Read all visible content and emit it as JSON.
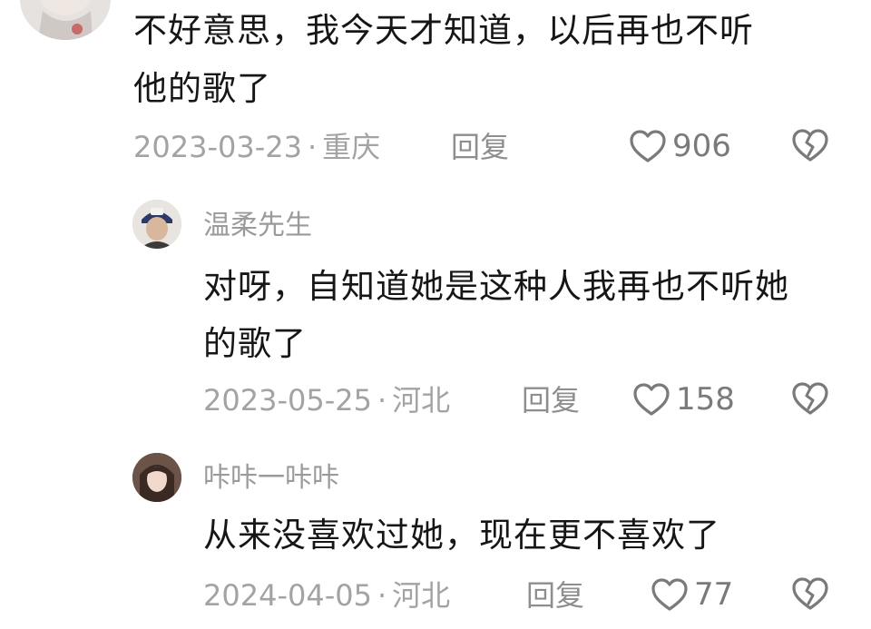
{
  "colors": {
    "text": "#161616",
    "meta": "#a3a3a3",
    "icon": "#7a7a7a"
  },
  "comments": [
    {
      "avatar": "partial-avatar-cut-off",
      "lines": [
        "不好意思，我今天才知道，以后再也不听",
        "他的歌了"
      ],
      "date": "2023-03-23",
      "separator": "·",
      "location": "重庆",
      "reply_label": "回复",
      "likes": "906"
    },
    {
      "username": "温柔先生",
      "avatar": "man-with-cap-avatar",
      "lines": [
        "对呀，自知道她是这种人我再也不听她",
        "的歌了"
      ],
      "date": "2023-05-25",
      "separator": "·",
      "location": "河北",
      "reply_label": "回复",
      "likes": "158"
    },
    {
      "username": "咔咔一咔咔",
      "avatar": "woman-portrait-avatar",
      "lines": [
        "从来没喜欢过她，现在更不喜欢了"
      ],
      "date": "2024-04-05",
      "separator": "·",
      "location": "河北",
      "reply_label": "回复",
      "likes": "77"
    }
  ]
}
